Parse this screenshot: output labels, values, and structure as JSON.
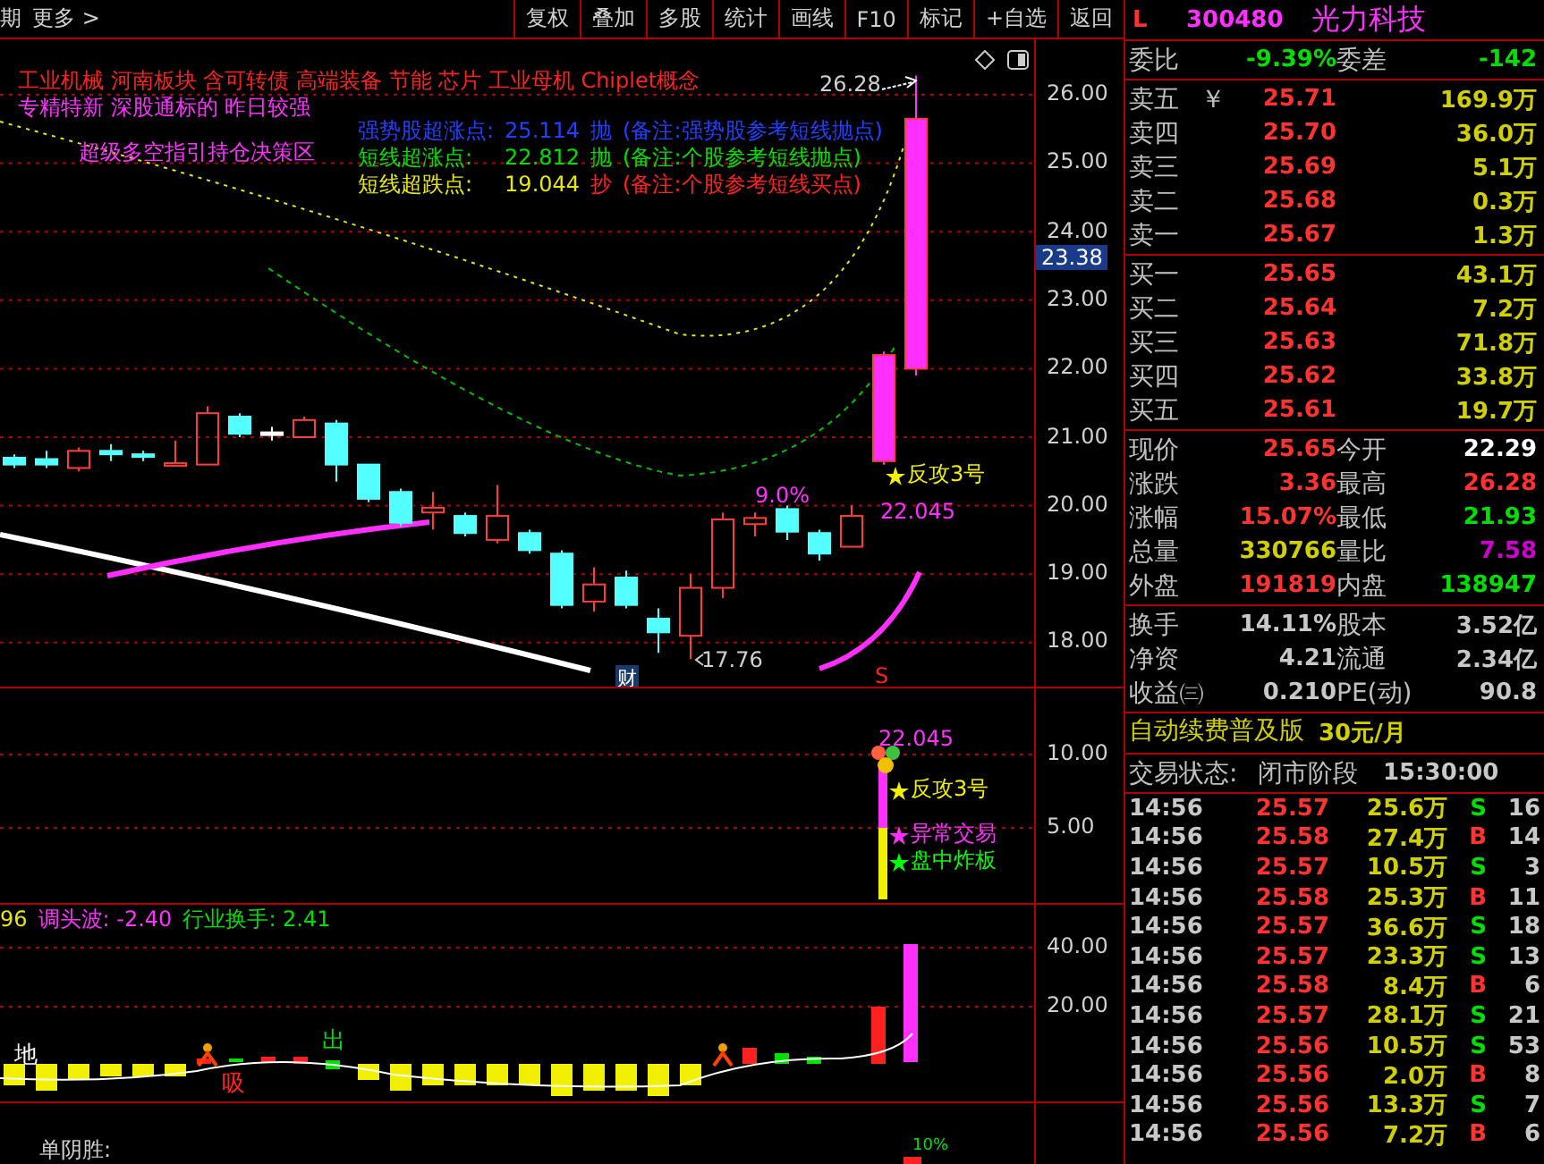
{
  "toolbar": {
    "left": [
      "期",
      "更多 >"
    ],
    "buttons": [
      "复权",
      "叠加",
      "多股",
      "统计",
      "画线",
      "F10",
      "标记",
      "+自选",
      "返回"
    ]
  },
  "main_chart": {
    "concepts": "工业机械 河南板块 含可转债 高端装备 节能 芯片 工业母机 Chiplet概念",
    "tags": "专精特新 深股通标的 昨日较强",
    "zone_label": "超级多空指引持仓决策区",
    "signals": [
      {
        "label": "强势股超涨点:",
        "value": "25.114",
        "action": "抛",
        "note": "(备注:强势股参考短线抛点)",
        "color": "#2040ff"
      },
      {
        "label": "短线超涨点:",
        "value": "22.812",
        "action": "抛",
        "note": "(备注:个股参考短线抛点)",
        "color": "#00e000"
      },
      {
        "label": "短线超跌点:",
        "value": "19.044",
        "action": "抄",
        "note": "(备注:个股参考短线买点)",
        "color": "#e8e800"
      }
    ],
    "high_marker": "26.28",
    "low_marker": "17.76",
    "pct_marker": "9.0%",
    "line_value": "22.045",
    "star_label": "反攻3号",
    "finance_badge": "财",
    "s_badge": "S",
    "yticks": [
      "26.00",
      "25.00",
      "24.00",
      "23.00",
      "22.00",
      "21.00",
      "20.00",
      "19.00",
      "18.00"
    ],
    "current_price": "23.38"
  },
  "signal_panel": {
    "value": "22.045",
    "stars": [
      {
        "label": "反攻3号",
        "color": "#f0f000"
      },
      {
        "label": "异常交易",
        "color": "#ff30ff"
      },
      {
        "label": "盘中炸板",
        "color": "#00ff00"
      }
    ],
    "yticks": [
      "10.00",
      "5.00"
    ]
  },
  "wave_panel": {
    "header": [
      {
        "text": "96",
        "color": "#e8e800"
      },
      {
        "text": "调头波: -2.40",
        "color": "#ff30ff"
      },
      {
        "text": "行业换手: 2.41",
        "color": "#00e000"
      }
    ],
    "marks": [
      "地",
      "吸",
      "出"
    ],
    "yticks": [
      "40.00",
      "20.00"
    ]
  },
  "bottom_panel": {
    "label": "单阴胜:",
    "pct": "10%"
  },
  "quote": {
    "flag": "L",
    "code": "300480",
    "name": "光力科技",
    "ratio": [
      {
        "label": "委比",
        "value": "-9.39%"
      },
      {
        "label": "委差",
        "value": "-142"
      }
    ],
    "asks": [
      {
        "label": "卖五",
        "mark": "￥",
        "price": "25.71",
        "volume": "169.9万"
      },
      {
        "label": "卖四",
        "price": "25.70",
        "volume": "36.0万"
      },
      {
        "label": "卖三",
        "price": "25.69",
        "volume": "5.1万"
      },
      {
        "label": "卖二",
        "price": "25.68",
        "volume": "0.3万"
      },
      {
        "label": "卖一",
        "price": "25.67",
        "volume": "1.3万"
      }
    ],
    "bids": [
      {
        "label": "买一",
        "price": "25.65",
        "volume": "43.1万"
      },
      {
        "label": "买二",
        "price": "25.64",
        "volume": "7.2万"
      },
      {
        "label": "买三",
        "price": "25.63",
        "volume": "71.8万"
      },
      {
        "label": "买四",
        "price": "25.62",
        "volume": "33.8万"
      },
      {
        "label": "买五",
        "price": "25.61",
        "volume": "19.7万"
      }
    ],
    "stats": [
      [
        {
          "label": "现价",
          "value": "25.65",
          "color": "#ff3232"
        },
        {
          "label": "今开",
          "value": "22.29",
          "color": "#ffffff"
        }
      ],
      [
        {
          "label": "涨跌",
          "value": "3.36",
          "color": "#ff3232"
        },
        {
          "label": "最高",
          "value": "26.28",
          "color": "#ff3232"
        }
      ],
      [
        {
          "label": "涨幅",
          "value": "15.07%",
          "color": "#ff3232"
        },
        {
          "label": "最低",
          "value": "21.93",
          "color": "#00e000"
        }
      ],
      [
        {
          "label": "总量",
          "value": "330766",
          "color": "#d0d000"
        },
        {
          "label": "量比",
          "value": "7.58",
          "color": "#d000d0"
        }
      ],
      [
        {
          "label": "外盘",
          "value": "191819",
          "color": "#ff3232"
        },
        {
          "label": "内盘",
          "value": "138947",
          "color": "#00e000"
        }
      ]
    ],
    "finance": [
      [
        {
          "label": "换手",
          "value": "14.11%"
        },
        {
          "label": "股本",
          "value": "3.52亿"
        }
      ],
      [
        {
          "label": "净资",
          "value": "4.21"
        },
        {
          "label": "流通",
          "value": "2.34亿"
        }
      ],
      [
        {
          "label": "收益㈢",
          "value": "0.210"
        },
        {
          "label": "PE(动)",
          "value": "90.8"
        }
      ]
    ],
    "promo": {
      "title": "自动续费普及版",
      "price": "30元/月"
    },
    "status": {
      "label": "交易状态:",
      "phase": "闭市阶段",
      "time": "15:30:00"
    },
    "trades": [
      {
        "time": "14:56",
        "price": "25.57",
        "volume": "25.6万",
        "side": "S",
        "kind": "sell",
        "count": "16"
      },
      {
        "time": "14:56",
        "price": "25.58",
        "volume": "27.4万",
        "side": "B",
        "kind": "buy",
        "count": "14"
      },
      {
        "time": "14:56",
        "price": "25.57",
        "volume": "10.5万",
        "side": "S",
        "kind": "sell",
        "count": "3"
      },
      {
        "time": "14:56",
        "price": "25.58",
        "volume": "25.3万",
        "side": "B",
        "kind": "buy",
        "count": "11"
      },
      {
        "time": "14:56",
        "price": "25.57",
        "volume": "36.6万",
        "side": "S",
        "kind": "sell",
        "count": "18"
      },
      {
        "time": "14:56",
        "price": "25.57",
        "volume": "23.3万",
        "side": "S",
        "kind": "sell",
        "count": "13"
      },
      {
        "time": "14:56",
        "price": "25.58",
        "volume": "8.4万",
        "side": "B",
        "kind": "buy",
        "count": "6"
      },
      {
        "time": "14:56",
        "price": "25.57",
        "volume": "28.1万",
        "side": "S",
        "kind": "sell",
        "count": "21"
      },
      {
        "time": "14:56",
        "price": "25.56",
        "volume": "10.5万",
        "side": "S",
        "kind": "sell",
        "count": "53"
      },
      {
        "time": "14:56",
        "price": "25.56",
        "volume": "2.0万",
        "side": "B",
        "kind": "buy",
        "count": "8"
      },
      {
        "time": "14:56",
        "price": "25.56",
        "volume": "13.3万",
        "side": "S",
        "kind": "sell",
        "count": "7"
      },
      {
        "time": "14:56",
        "price": "25.56",
        "volume": "7.2万",
        "side": "B",
        "kind": "buy",
        "count": "6"
      }
    ]
  }
}
